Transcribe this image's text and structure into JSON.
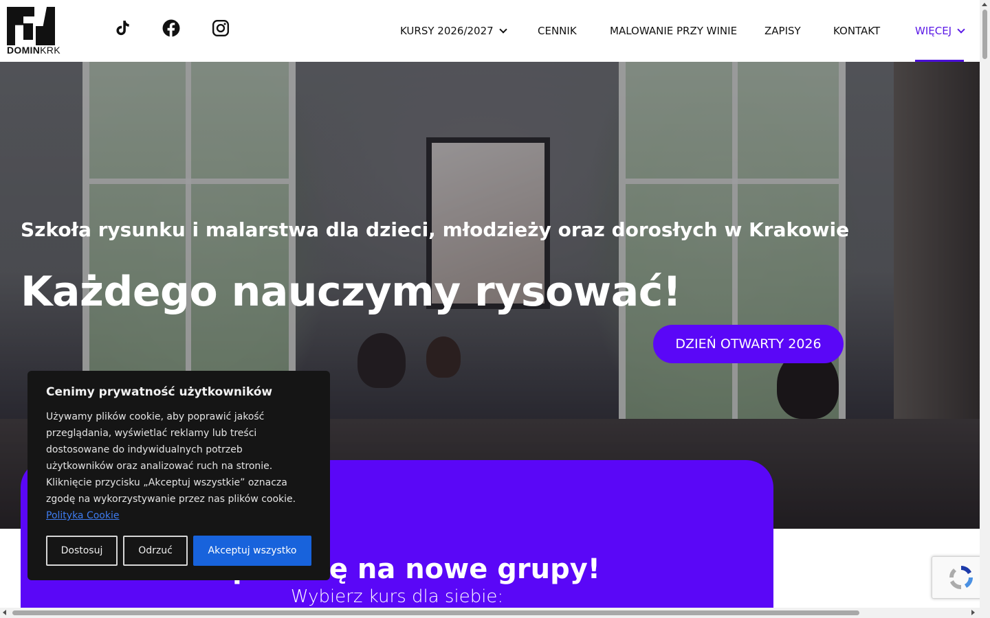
{
  "header": {
    "logo": {
      "text_bold": "DOMIN",
      "text_thin": "KRK"
    },
    "social": [
      {
        "icon": "tiktok-icon"
      },
      {
        "icon": "facebook-icon"
      },
      {
        "icon": "instagram-icon"
      }
    ],
    "nav": [
      {
        "label": "KURSY 2026/2027",
        "dropdown": true
      },
      {
        "label": "CENNIK"
      },
      {
        "label": "MALOWANIE PRZY WINIE"
      },
      {
        "label": "ZAPISY"
      },
      {
        "label": "KONTAKT"
      },
      {
        "label": "WIĘCEJ",
        "dropdown": true,
        "active": true
      }
    ]
  },
  "hero": {
    "subtitle": "Szkoła rysunku i malarstwa dla dzieci, młodzieży oraz dorosłych w Krakowie",
    "headline": "Każdego nauczymy rysować!",
    "cta": "DZIEŃ OTWARTY 2026"
  },
  "promo": {
    "title": "Zapisz się na nowe grupy!",
    "subtitle": "Wybierz kurs dla siebie:"
  },
  "cookie": {
    "title": "Cenimy prywatność użytkowników",
    "body": "Używamy plików cookie, aby poprawić jakość przeglądania, wyświetlać reklamy lub treści dostosowane do indywidualnych potrzeb użytkowników oraz analizować ruch na stronie. Kliknięcie przycisku „Akceptuj wszystkie” oznacza zgodę na wykorzystywanie przez nas plików cookie.",
    "link": "Polityka Cookie",
    "buttons": {
      "customize": "Dostosuj",
      "reject": "Odrzuć",
      "accept": "Akceptuj wszystko"
    }
  },
  "colors": {
    "accent": "#5a07f7",
    "nav_active": "#5a18e6",
    "cookie_bg": "#151515",
    "cookie_primary": "#1863dc"
  }
}
